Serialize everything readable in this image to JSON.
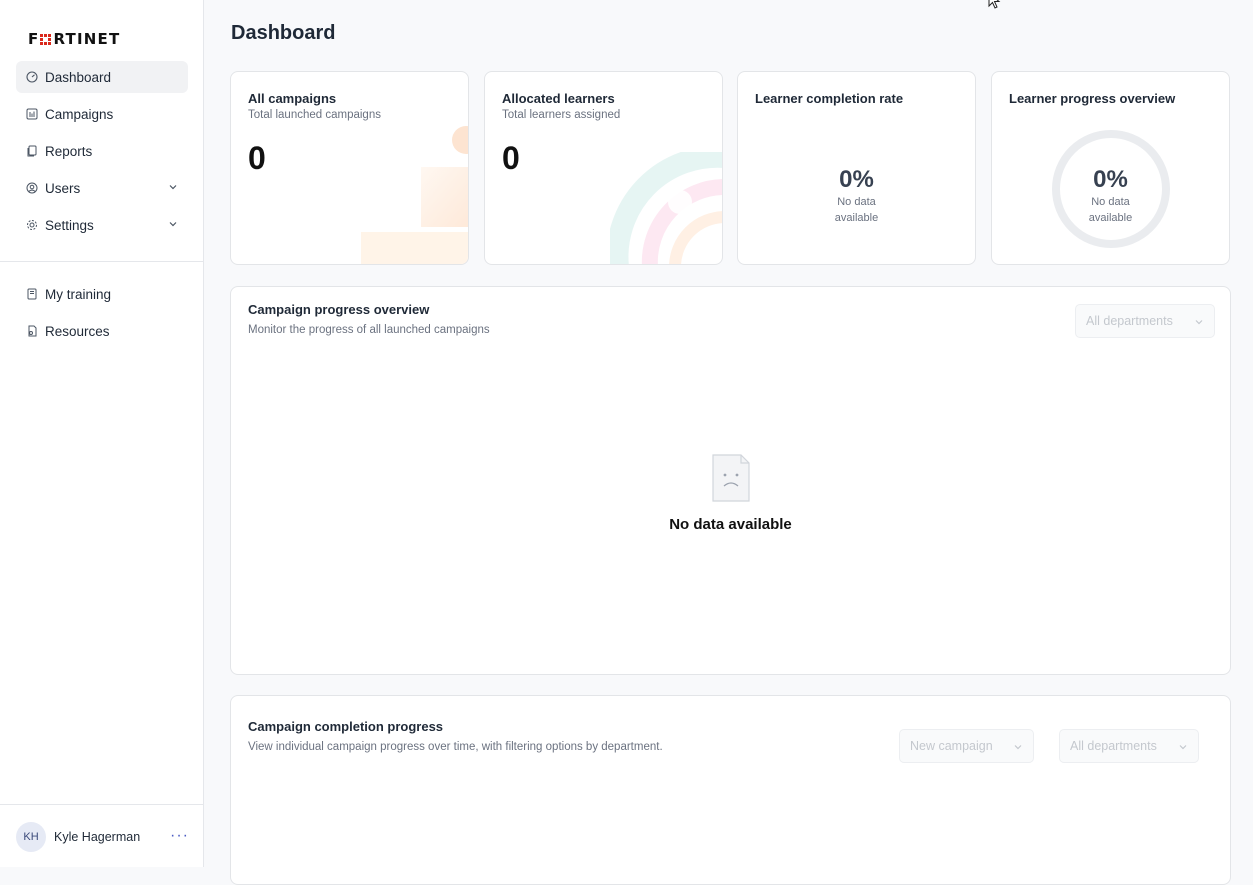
{
  "brand": {
    "logo_text_left": "F",
    "logo_text_right": "RTINET"
  },
  "sidebar": {
    "items": [
      {
        "label": "Dashboard",
        "icon": "gauge-icon",
        "active": true
      },
      {
        "label": "Campaigns",
        "icon": "bar-chart-icon"
      },
      {
        "label": "Reports",
        "icon": "document-icon"
      },
      {
        "label": "Users",
        "icon": "user-circle-icon",
        "expandable": true
      },
      {
        "label": "Settings",
        "icon": "gear-icon",
        "expandable": true
      }
    ],
    "secondary": [
      {
        "label": "My training",
        "icon": "book-icon"
      },
      {
        "label": "Resources",
        "icon": "resource-icon"
      }
    ],
    "user": {
      "initials": "KH",
      "name": "Kyle Hagerman",
      "more": "···"
    }
  },
  "page": {
    "title": "Dashboard"
  },
  "cards": {
    "all_campaigns": {
      "title": "All campaigns",
      "subtitle": "Total launched campaigns",
      "value": "0"
    },
    "allocated_learners": {
      "title": "Allocated learners",
      "subtitle": "Total learners assigned",
      "value": "0"
    },
    "completion_rate": {
      "title": "Learner completion rate",
      "value": "0%",
      "note_line1": "No data",
      "note_line2": "available"
    },
    "progress_overview": {
      "title": "Learner progress overview",
      "value": "0%",
      "note_line1": "No data",
      "note_line2": "available"
    }
  },
  "campaign_progress": {
    "title": "Campaign progress overview",
    "subtitle": "Monitor the progress of all launched campaigns",
    "filter": "All departments",
    "empty_text": "No data available"
  },
  "campaign_completion": {
    "title": "Campaign completion progress",
    "subtitle": "View individual campaign progress over time, with filtering options by department.",
    "campaign_filter": "New campaign",
    "department_filter": "All departments"
  },
  "colors": {
    "brand_red": "#da291c",
    "accent": "#4b5cc4",
    "border": "#e3e5e8"
  }
}
